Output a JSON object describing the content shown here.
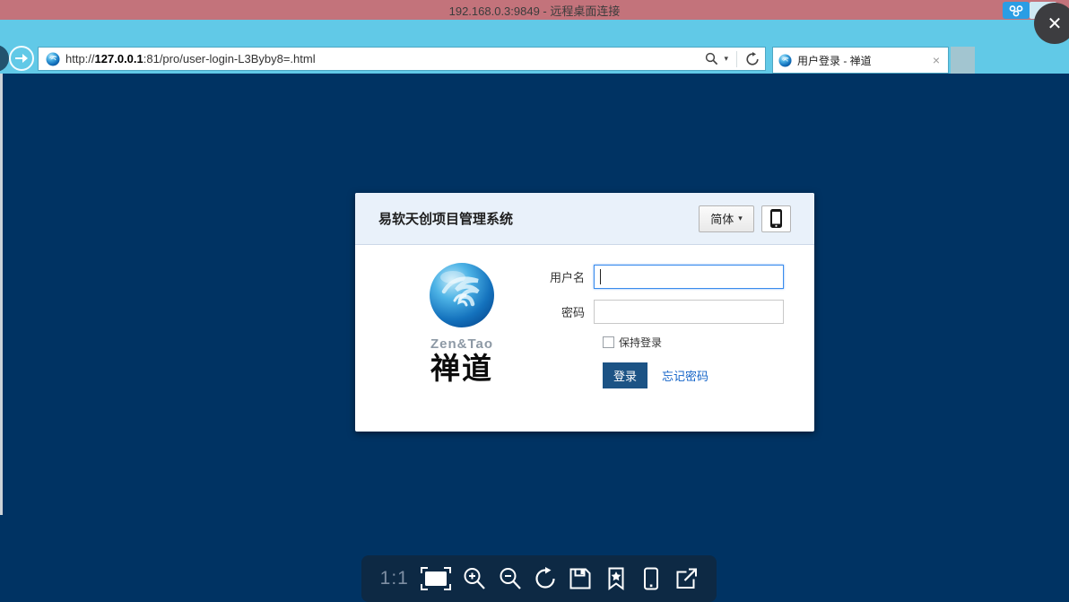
{
  "window": {
    "title": "192.168.0.3:9849 - 远程桌面连接",
    "close_glyph": "✕"
  },
  "browser": {
    "url": {
      "scheme": "http://",
      "host": "127.0.0.1",
      "path": ":81/pro/user-login-L3Byby8=.html"
    },
    "search_caret_glyph": "▾",
    "tab_title": "用户登录 - 禅道",
    "tab_close_glyph": "×"
  },
  "login_card": {
    "title": "易软天创项目管理系统",
    "language_label": "简体",
    "language_caret_glyph": "▾",
    "brand_en": "Zen&Tao",
    "brand_cn": "禅道",
    "username_label": "用户名",
    "username_value": "",
    "password_label": "密码",
    "password_value": "",
    "keep_login_label": "保持登录",
    "login_button_label": "登录",
    "forgot_password_label": "忘记密码"
  },
  "viewer_toolbar": {
    "scale_label": "1:1"
  },
  "colors": {
    "titlebar": "#c3737b",
    "browser_chrome": "#61c9e7",
    "page_background": "#003363",
    "focus_border": "#3a8ced",
    "login_button": "#1c5385",
    "link": "#1464c8",
    "toolbar_background": "#0d2944",
    "card_header": "#e9f1fa"
  }
}
